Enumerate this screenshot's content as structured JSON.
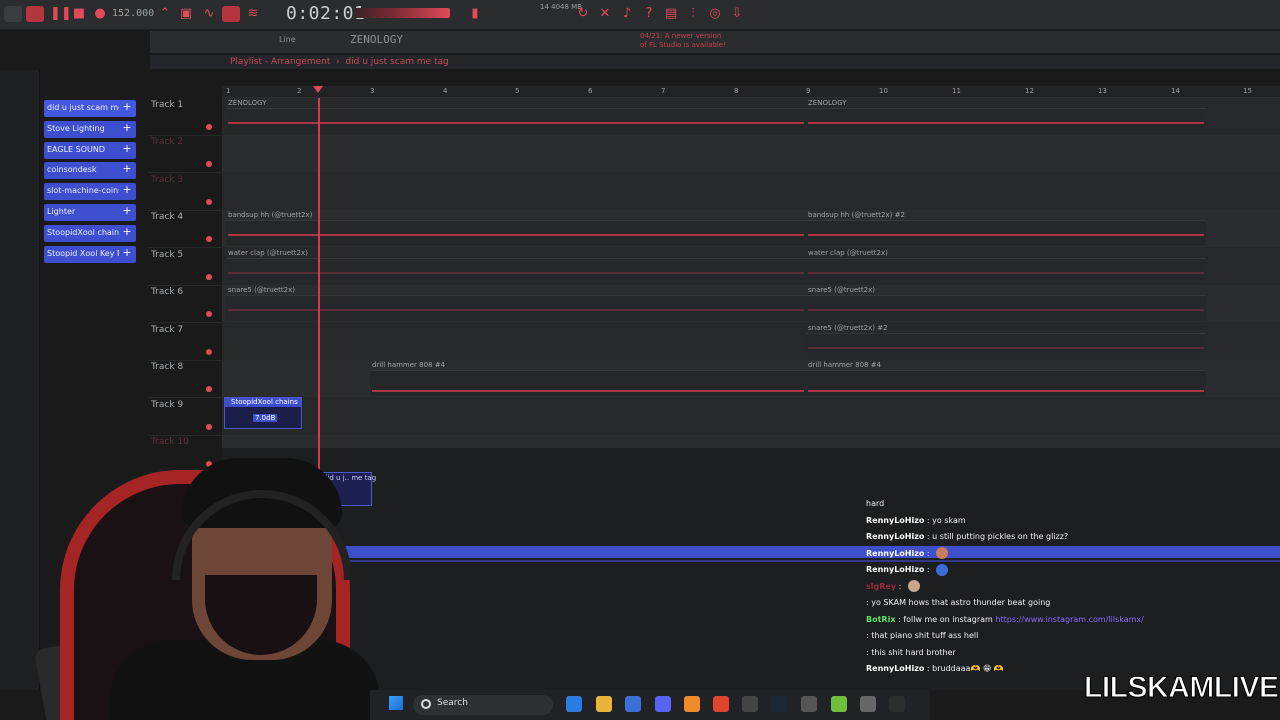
{
  "toolbar": {
    "bpm": "152.000",
    "time": "0:02:01",
    "memory": "14\n4048 MB",
    "line_mode": "Line",
    "instrument": "ZENOLOGY",
    "notice": "04/21: A newer version of FL Studio is available!"
  },
  "playlist": {
    "title_prefix": "Playlist - Arrangement",
    "title_pattern": "did u just scam me tag",
    "ruler": [
      "1",
      "2",
      "3",
      "4",
      "5",
      "6",
      "7",
      "8",
      "9",
      "10",
      "11",
      "12",
      "13",
      "14",
      "15"
    ]
  },
  "picker": [
    "did u just scam me t..",
    "Stove Lighting",
    "EAGLE SOUND",
    "coinsondesk",
    "slot-machine-coins",
    "Lighter",
    "StoopidXool chains",
    "Stoopid Xool Key FX"
  ],
  "tracks": [
    {
      "name": "Track 1",
      "dim": false,
      "clips": [
        "ZENOLOGY",
        "ZENOLOGY"
      ]
    },
    {
      "name": "Track 2",
      "dim": true,
      "clips": []
    },
    {
      "name": "Track 3",
      "dim": true,
      "clips": []
    },
    {
      "name": "Track 4",
      "dim": false,
      "clips": [
        "bandsup hh (@truett2x)",
        "bandsup hh (@truett2x) #2"
      ]
    },
    {
      "name": "Track 5",
      "dim": false,
      "clips": [
        "water clap (@truett2x)",
        "water clap (@truett2x)"
      ]
    },
    {
      "name": "Track 6",
      "dim": false,
      "clips": [
        "snare5 (@truett2x)",
        "snare5 (@truett2x)"
      ]
    },
    {
      "name": "Track 7",
      "dim": false,
      "clips": [
        "snare5 (@truett2x) #2"
      ]
    },
    {
      "name": "Track 8",
      "dim": false,
      "clips": [
        "drill hammer 808 #4",
        "drill hammer 808 #4"
      ]
    },
    {
      "name": "Track 9",
      "dim": false,
      "clips": []
    },
    {
      "name": "Track 10",
      "dim": true,
      "clips": []
    }
  ],
  "audio_clips": {
    "stoopid": {
      "label": "StoopidXool chains",
      "gain": "7.0dB"
    },
    "tag": {
      "label": "did u j.. me tag"
    }
  },
  "chat": [
    {
      "user": "",
      "text": "hard",
      "color": "red"
    },
    {
      "user": "RennyLoHizo",
      "text": " : yo skam",
      "color": "white"
    },
    {
      "user": "RennyLoHizo",
      "text": " : u still putting pickles on the glizz?",
      "color": "white"
    },
    {
      "user": "RennyLoHizo",
      "text": " : ",
      "color": "white",
      "emote": "#c97b5e"
    },
    {
      "user": "RennyLoHizo",
      "text": " : ",
      "color": "white",
      "emote": "#3d6bd8"
    },
    {
      "user": "slgRey",
      "text": " : ",
      "color": "red",
      "emote": "#c9a590"
    },
    {
      "user": "",
      "text": " : yo SKAM hows that astro thunder beat going",
      "color": "red"
    },
    {
      "user": "BotRix",
      "text": " : follw me on instagram ",
      "color": "green",
      "link": "https://www.instagram.com/lilskamx/"
    },
    {
      "user": "",
      "text": " : that piano shit tuff ass hell",
      "color": "red"
    },
    {
      "user": "",
      "text": " : this shit hard brother",
      "color": "red"
    },
    {
      "user": "RennyLoHizo",
      "text": " : bruddaaa🫶 😁 🫶",
      "color": "white"
    }
  ],
  "taskbar": {
    "search_label": "Search"
  },
  "brand": "LILSKAMLIVE"
}
